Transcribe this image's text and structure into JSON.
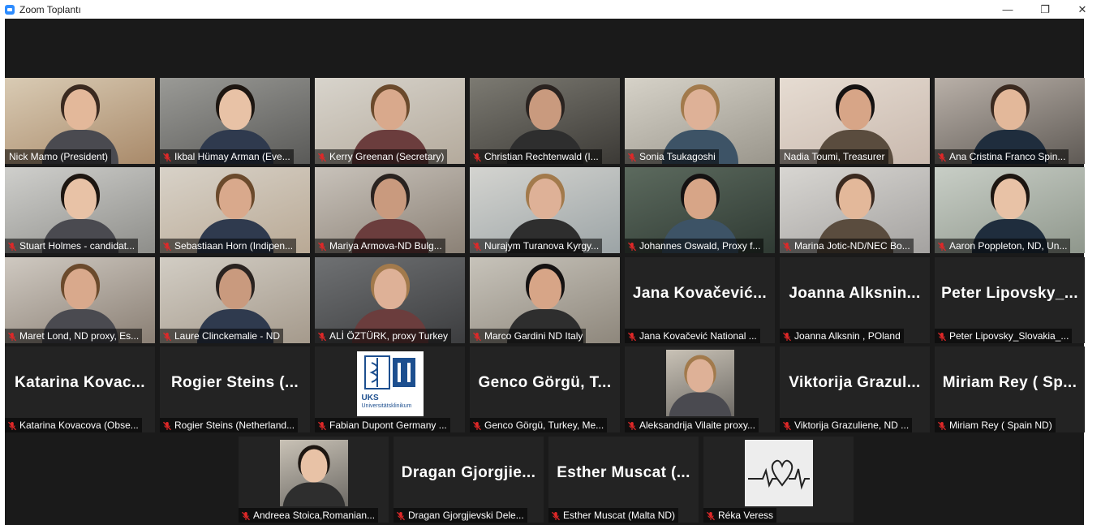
{
  "window": {
    "title": "Zoom Toplantı",
    "controls": {
      "minimize": "—",
      "maximize": "❐",
      "close": "✕"
    }
  },
  "colors": {
    "stage": "#1a1a1a",
    "tile": "#232323",
    "active_speaker": "#c6e37a",
    "mute": "#e02828"
  },
  "participants": [
    {
      "name": "Nick Mamo (President)",
      "muted": false,
      "video": true
    },
    {
      "name": "Ikbal Hümay Arman (Eve...",
      "muted": true,
      "video": true
    },
    {
      "name": "Kerry Greenan (Secretary)",
      "muted": true,
      "video": true
    },
    {
      "name": "Christian Rechtenwald (I...",
      "muted": true,
      "video": true
    },
    {
      "name": "Sonia Tsukagoshi",
      "muted": true,
      "video": true
    },
    {
      "name": "Nadia Toumi, Treasurer",
      "muted": false,
      "video": true,
      "active": true
    },
    {
      "name": "Ana Cristina Franco Spin...",
      "muted": true,
      "video": true
    },
    {
      "name": "Stuart Holmes - candidat...",
      "muted": true,
      "video": true
    },
    {
      "name": "Sebastiaan Horn (Indipen...",
      "muted": true,
      "video": true
    },
    {
      "name": "Mariya Armova-ND Bulg...",
      "muted": true,
      "video": true
    },
    {
      "name": "Nurajym Turanova Kyrgy...",
      "muted": true,
      "video": true
    },
    {
      "name": "Johannes Oswald, Proxy f...",
      "muted": true,
      "video": true
    },
    {
      "name": "Marina Jotic-ND/NEC Bo...",
      "muted": true,
      "video": true
    },
    {
      "name": "Aaron Poppleton, ND, Un...",
      "muted": true,
      "video": true
    },
    {
      "name": "Maret Lond, ND proxy, Es...",
      "muted": true,
      "video": true
    },
    {
      "name": "Laure Clinckemalie - ND",
      "muted": true,
      "video": true
    },
    {
      "name": "ALİ ÖZTÜRK, proxy Turkey",
      "muted": true,
      "video": true
    },
    {
      "name": "Marco Gardini ND Italy",
      "muted": true,
      "video": true
    },
    {
      "name": "Jana Kovačević National ...",
      "display": "Jana Kovačević...",
      "muted": true,
      "video": false
    },
    {
      "name": "Joanna Alksnin , POland",
      "display": "Joanna Alksnin...",
      "muted": true,
      "video": false
    },
    {
      "name": "Peter Lipovsky_Slovakia_...",
      "display": "Peter Lipovsky_...",
      "muted": true,
      "video": false
    },
    {
      "name": "Katarina Kovacova (Obse...",
      "display": "Katarina Kovac...",
      "muted": true,
      "video": false
    },
    {
      "name": "Rogier Steins (Netherland...",
      "display": "Rogier Steins (...",
      "muted": true,
      "video": false
    },
    {
      "name": "Fabian Dupont Germany ...",
      "muted": true,
      "video": false,
      "logo": {
        "line1": "UKS",
        "line2": "Universitätsklinikum"
      }
    },
    {
      "name": "Genco Görgü, Turkey, Me...",
      "display": "Genco Görgü, T...",
      "muted": true,
      "video": false
    },
    {
      "name": "Aleksandrija Vilaite proxy...",
      "muted": true,
      "video": false,
      "avatar": true
    },
    {
      "name": "Viktorija Grazuliene, ND ...",
      "display": "Viktorija Grazul...",
      "muted": true,
      "video": false
    },
    {
      "name": "Miriam Rey ( Spain ND)",
      "display": "Miriam Rey ( Sp...",
      "muted": true,
      "video": false
    },
    {
      "name": "Andreea Stoica,Romanian...",
      "muted": true,
      "video": false,
      "avatar": true
    },
    {
      "name": "Dragan Gjorgjievski Dele...",
      "display": "Dragan Gjorgjie...",
      "muted": true,
      "video": false
    },
    {
      "name": "Esther Muscat (Malta ND)",
      "display": "Esther Muscat (...",
      "muted": true,
      "video": false
    },
    {
      "name": "Réka Veress",
      "muted": true,
      "video": false,
      "heart": true
    }
  ]
}
